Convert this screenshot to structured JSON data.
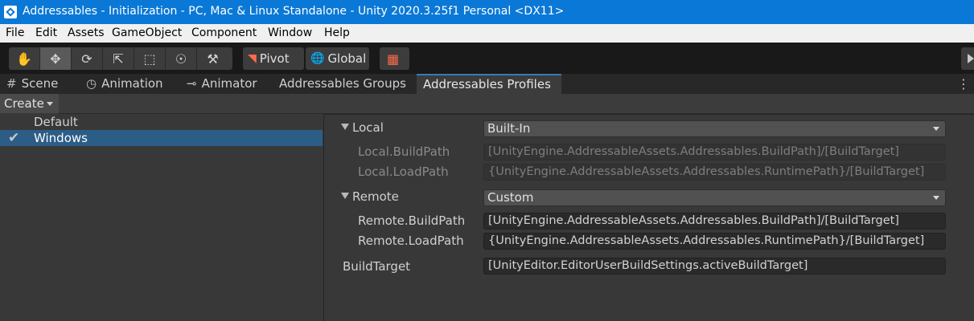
{
  "window": {
    "title": "Addressables - Initialization - PC, Mac & Linux Standalone - Unity 2020.3.25f1 Personal <DX11>"
  },
  "menu": [
    "File",
    "Edit",
    "Assets",
    "GameObject",
    "Component",
    "Window",
    "Help"
  ],
  "toolbar": {
    "tools": [
      "hand-tool-icon",
      "move-tool-icon",
      "rotate-tool-icon",
      "scale-tool-icon",
      "rect-tool-icon",
      "transform-tool-icon",
      "custom-tool-icon"
    ],
    "active_tool": "move-tool-icon",
    "pivot_label": "Pivot",
    "global_label": "Global",
    "accent_color": "#ff6b4a"
  },
  "tabs": [
    {
      "label": "Scene",
      "icon": "grid-icon"
    },
    {
      "label": "Animation",
      "icon": "clock-icon"
    },
    {
      "label": "Animator",
      "icon": "animator-icon"
    },
    {
      "label": "Addressables Groups",
      "icon": ""
    },
    {
      "label": "Addressables Profiles",
      "icon": "",
      "active": true
    }
  ],
  "create_label": "Create",
  "profiles": [
    {
      "name": "Default",
      "selected": false
    },
    {
      "name": "Windows",
      "selected": true
    }
  ],
  "inspector": {
    "local": {
      "label": "Local",
      "mode": "Built-In",
      "build_path_label": "Local.BuildPath",
      "build_path_value": "[UnityEngine.AddressableAssets.Addressables.BuildPath]/[BuildTarget]",
      "load_path_label": "Local.LoadPath",
      "load_path_value": "{UnityEngine.AddressableAssets.Addressables.RuntimePath}/[BuildTarget]"
    },
    "remote": {
      "label": "Remote",
      "mode": "Custom",
      "build_path_label": "Remote.BuildPath",
      "build_path_value": "[UnityEngine.AddressableAssets.Addressables.BuildPath]/[BuildTarget]",
      "load_path_label": "Remote.LoadPath",
      "load_path_value": "{UnityEngine.AddressableAssets.Addressables.RuntimePath}/[BuildTarget]"
    },
    "build_target": {
      "label": "BuildTarget",
      "value": "[UnityEditor.EditorUserBuildSettings.activeBuildTarget]"
    }
  },
  "colors": {
    "titlebar": "#0a78d7",
    "selection": "#2c5d87",
    "tab_accent": "#3a79bb"
  }
}
